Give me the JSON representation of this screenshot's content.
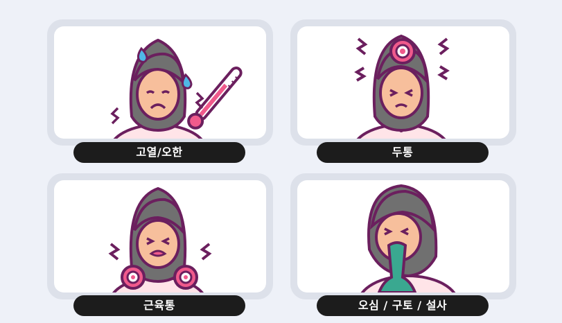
{
  "symptoms": [
    {
      "label": "고열/오한",
      "icon": "fever-chills-icon"
    },
    {
      "label": "두통",
      "icon": "headache-icon"
    },
    {
      "label": "근육통",
      "icon": "muscle-pain-icon"
    },
    {
      "label": "오심 / 구토 / 설사",
      "icon": "nausea-vomiting-diarrhea-icon"
    }
  ],
  "colors": {
    "background": "#eef1f8",
    "card_border": "#dde1ea",
    "label_bg": "#1c1c1c",
    "label_text": "#ffffff",
    "hair": "#707070",
    "outline": "#6b1f5e",
    "skin": "#f7bf9c",
    "accent_pink": "#f05a8c",
    "drop_blue": "#4fb8e6",
    "vomit_teal": "#3aa890"
  }
}
